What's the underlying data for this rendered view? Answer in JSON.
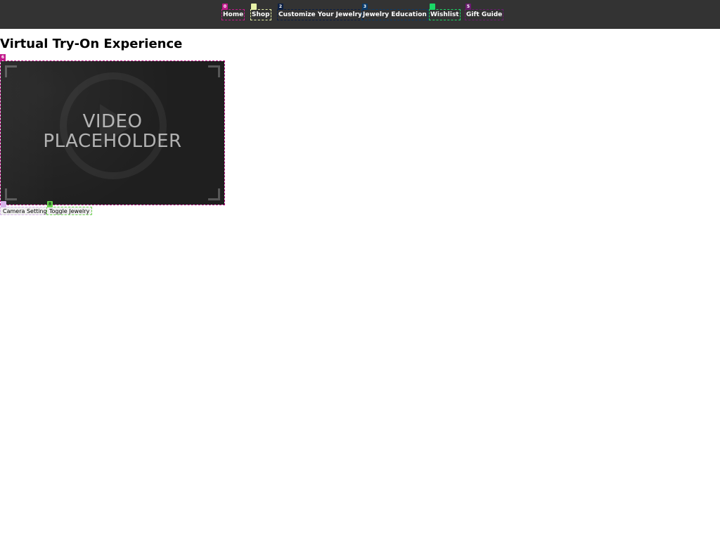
{
  "nav": {
    "items": [
      {
        "label": "Home",
        "badge": "0"
      },
      {
        "label": "Shop",
        "badge": ""
      },
      {
        "label": "Customize Your Jewelry",
        "badge": "2"
      },
      {
        "label": "Jewelry Education",
        "badge": "3"
      },
      {
        "label": "Wishlist",
        "badge": ""
      },
      {
        "label": "Gift Guide",
        "badge": "5"
      }
    ]
  },
  "main": {
    "title": "Virtual Try-On Experience",
    "video_badge": "6",
    "video": {
      "placeholder_text": "VIDEO PLACEHOLDER",
      "icon": "play-icon"
    },
    "controls": {
      "camera_badge": "",
      "camera_label": "Camera Settings",
      "toggle_badge": "8",
      "toggle_label": "Toggle Jewelry"
    }
  },
  "colors": {
    "topbar_bg": "#333333",
    "page_bg": "#ffffff",
    "video_bg": "#1f1f1f"
  }
}
